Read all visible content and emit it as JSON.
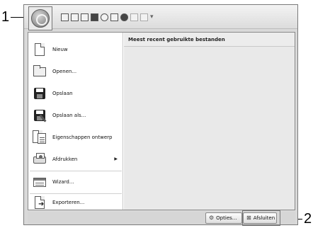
{
  "callouts": {
    "left": "1",
    "right": "2"
  },
  "quick_access": [
    "new-icon",
    "open-icon",
    "save-icon",
    "record-icon",
    "select-icon",
    "stitch-icon",
    "zoom-icon",
    "undo-icon",
    "redo-icon",
    "customize-icon"
  ],
  "menu": {
    "items": [
      {
        "label": "Nieuw",
        "icon": "new-document-icon"
      },
      {
        "label": "Openen...",
        "icon": "open-folder-icon"
      },
      {
        "label": "Opslaan",
        "icon": "save-disk-icon"
      },
      {
        "label": "Opslaan als...",
        "icon": "save-as-icon"
      },
      {
        "label": "Eigenschappen ontwerp",
        "icon": "design-properties-icon"
      },
      {
        "label": "Afdrukken",
        "icon": "printer-icon",
        "submenu": true
      },
      {
        "label": "Wizard...",
        "icon": "wizard-icon"
      },
      {
        "label": "Exporteren...",
        "icon": "export-icon"
      }
    ],
    "recent_header": "Meest recent gebruikte bestanden"
  },
  "footer": {
    "options_label": "Opties...",
    "exit_label": "Afsluiten"
  },
  "colors": {
    "menu_bg": "#ffffff",
    "recent_bg": "#e9e9e9",
    "frame_bg": "#d9d9d9"
  }
}
